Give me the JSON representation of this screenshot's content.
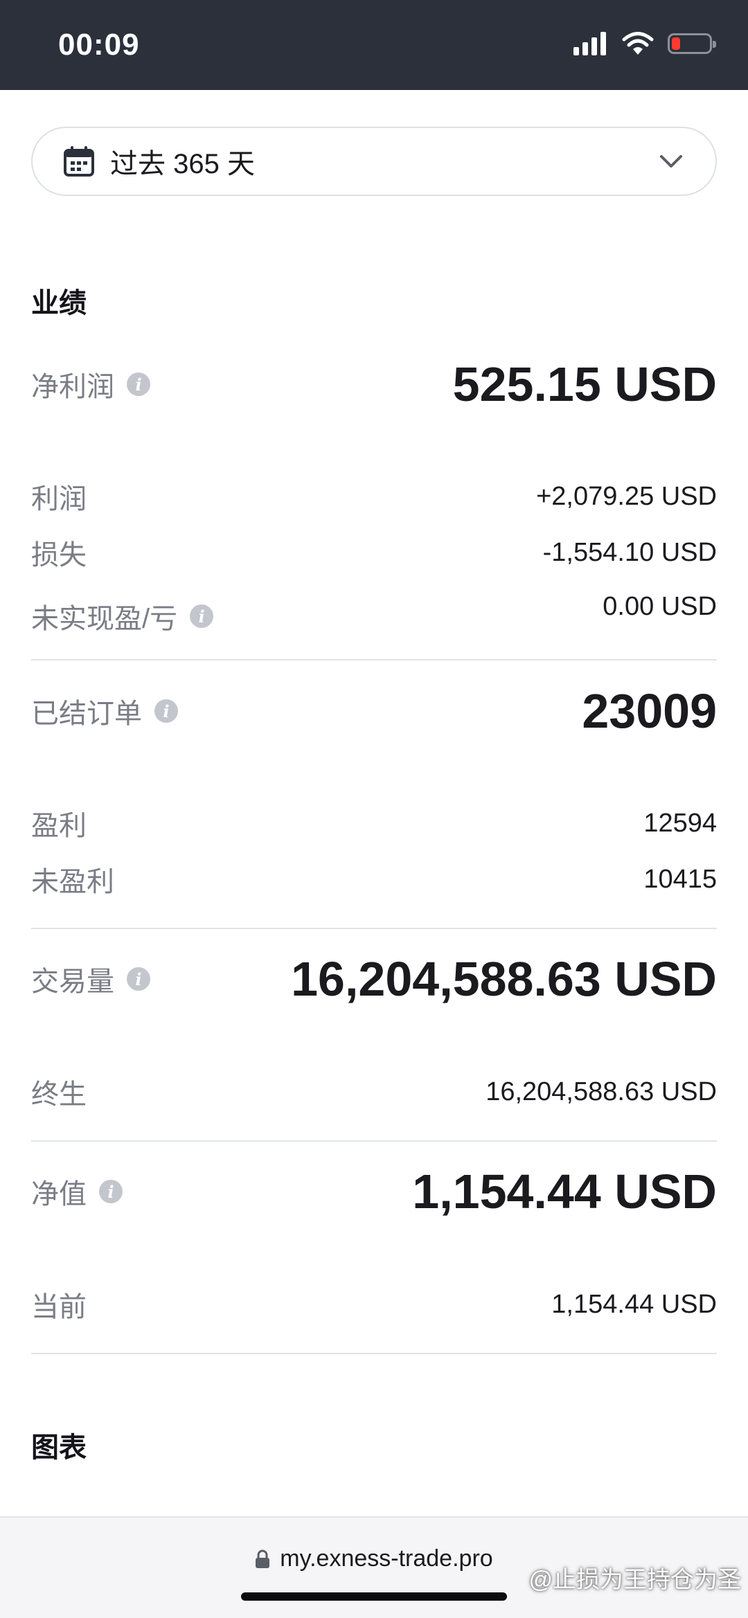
{
  "status_bar": {
    "time": "00:09"
  },
  "date_filter": {
    "label": "过去 365 天"
  },
  "performance": {
    "title": "业绩",
    "net_profit": {
      "label": "净利润",
      "value": "525.15 USD"
    },
    "profit": {
      "label": "利润",
      "value": "+2,079.25 USD"
    },
    "loss": {
      "label": "损失",
      "value": "-1,554.10 USD"
    },
    "unrealized": {
      "label": "未实现盈/亏",
      "value": "0.00 USD"
    },
    "closed_orders": {
      "label": "已结订单",
      "value": "23009"
    },
    "profitable": {
      "label": "盈利",
      "value": "12594"
    },
    "unprofitable": {
      "label": "未盈利",
      "value": "10415"
    },
    "volume": {
      "label": "交易量",
      "value": "16,204,588.63 USD"
    },
    "lifetime": {
      "label": "终生",
      "value": "16,204,588.63 USD"
    },
    "equity": {
      "label": "净值",
      "value": "1,154.44 USD"
    },
    "current": {
      "label": "当前",
      "value": "1,154.44 USD"
    }
  },
  "charts": {
    "title": "图表"
  },
  "browser": {
    "url": "my.exness-trade.pro"
  },
  "watermark": "@止损为王持仓为圣",
  "info_glyph": "i"
}
